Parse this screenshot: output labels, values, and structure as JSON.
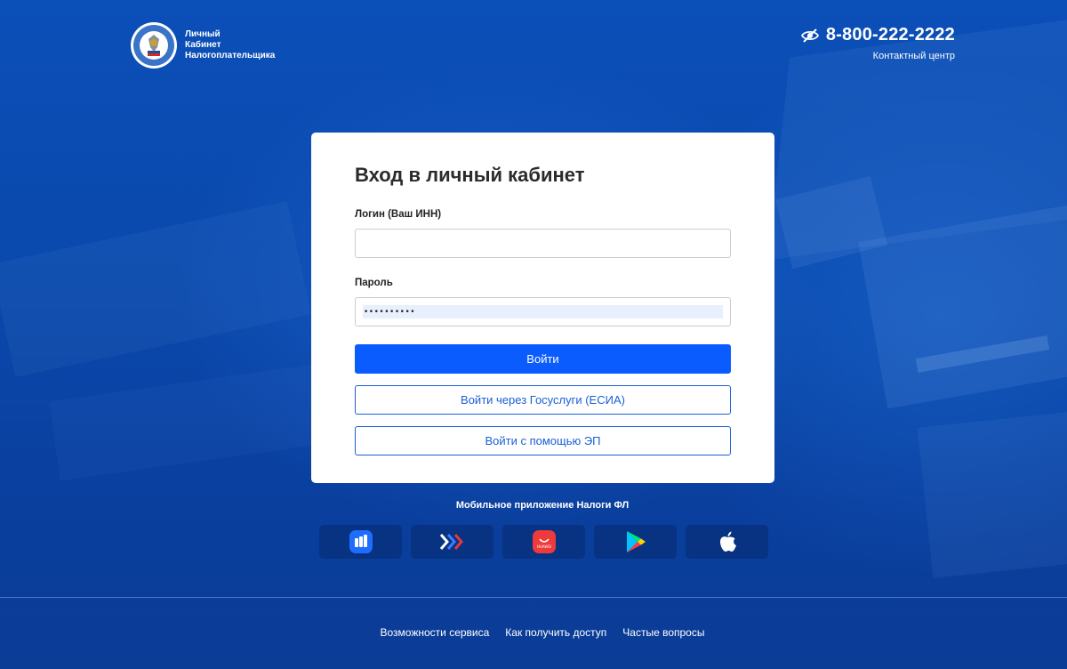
{
  "header": {
    "logo_lines": [
      "Личный",
      "Кабинет",
      "Налогоплательщика"
    ],
    "phone": "8-800-222-2222",
    "contact_label": "Контактный центр"
  },
  "login_form": {
    "title": "Вход в личный кабинет",
    "login_label": "Логин (Ваш ИНН)",
    "login_value": "",
    "password_label": "Пароль",
    "password_value": "••••••••••",
    "submit_label": "Войти",
    "gosuslugi_label": "Войти через Госуслуги (ЕСИА)",
    "ep_label": "Войти с помощью ЭП"
  },
  "mobile": {
    "title": "Мобильное приложение Налоги ФЛ",
    "stores": [
      {
        "icon": "rustore-icon"
      },
      {
        "icon": "nashstore-icon"
      },
      {
        "icon": "huawei-appgallery-icon",
        "badge": "HUAWEI"
      },
      {
        "icon": "google-play-icon"
      },
      {
        "icon": "apple-app-store-icon"
      }
    ]
  },
  "footer": {
    "links": [
      "Возможности сервиса",
      "Как получить доступ",
      "Частые вопросы"
    ]
  },
  "colors": {
    "background": "#0b46a8",
    "primary_button": "#0a5cff",
    "outline_button": "#1a5fd6"
  }
}
